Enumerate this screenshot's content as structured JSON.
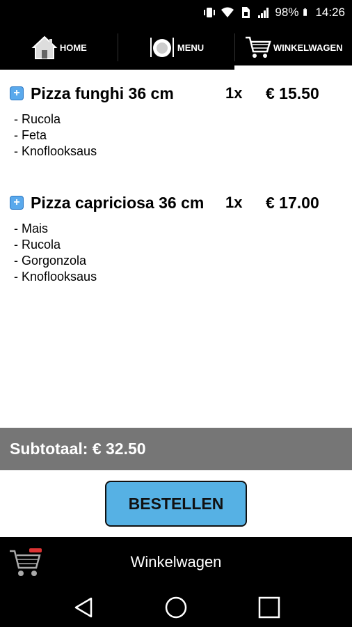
{
  "status_bar": {
    "battery": "98%",
    "time": "14:26"
  },
  "top_nav": {
    "tabs": [
      {
        "label": "HOME",
        "icon": "home-icon"
      },
      {
        "label": "MENU",
        "icon": "plate-cutlery-icon"
      },
      {
        "label": "WINKELWAGEN",
        "icon": "shopping-cart-icon",
        "active": true
      }
    ]
  },
  "cart": {
    "items": [
      {
        "name": "Pizza funghi 36 cm",
        "quantity": "1x",
        "price": "€ 15.50",
        "extras": [
          "- Rucola",
          "- Feta",
          "- Knoflooksaus"
        ]
      },
      {
        "name": "Pizza capriciosa 36 cm",
        "quantity": "1x",
        "price": "€ 17.00",
        "extras": [
          "- Mais",
          "- Rucola",
          "- Gorgonzola",
          "- Knoflooksaus"
        ]
      }
    ]
  },
  "subtotal": {
    "text": "Subtotaal: € 32.50"
  },
  "order_button": {
    "label": "BESTELLEN"
  },
  "bottom_bar": {
    "title": "Winkelwagen",
    "icon": "shopping-cart-icon"
  },
  "system_nav": {
    "buttons": [
      "back-icon",
      "home-circle-icon",
      "recents-icon"
    ]
  },
  "colors": {
    "accent": "#56b1e4",
    "subtotal_bg": "#767676",
    "bar_bg": "#000000"
  }
}
